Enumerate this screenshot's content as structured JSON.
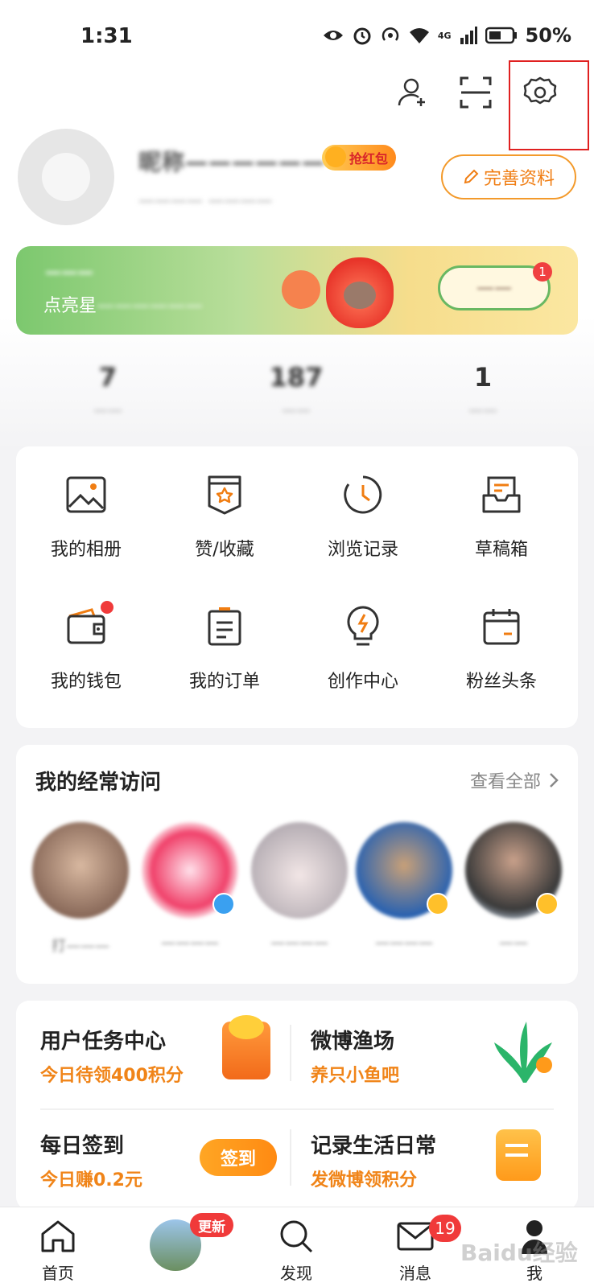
{
  "status_bar": {
    "time": "1:31",
    "network_label": "4G",
    "battery": "50%"
  },
  "header": {
    "add_friend_icon": "person-add-icon",
    "scan_icon": "scan-icon",
    "settings_icon": "gear-icon"
  },
  "profile": {
    "username": "昵称——————",
    "redpacket_label": "抢红包",
    "bio": "———— ————",
    "edit_label": "完善资料"
  },
  "banner": {
    "title": "———",
    "subtitle_prefix": "点亮星",
    "subtitle_hidden": "——————",
    "button_label": "——",
    "badge": "1"
  },
  "stats": [
    {
      "value": "7",
      "label": "——"
    },
    {
      "value": "187",
      "label": "——"
    },
    {
      "value": "1",
      "label": "——"
    }
  ],
  "grid": [
    {
      "label": "我的相册",
      "icon": "image-icon"
    },
    {
      "label": "赞/收藏",
      "icon": "bookmark-star-icon"
    },
    {
      "label": "浏览记录",
      "icon": "clock-icon"
    },
    {
      "label": "草稿箱",
      "icon": "inbox-icon"
    },
    {
      "label": "我的钱包",
      "icon": "wallet-icon"
    },
    {
      "label": "我的订单",
      "icon": "order-list-icon"
    },
    {
      "label": "创作中心",
      "icon": "lightbulb-icon"
    },
    {
      "label": "粉丝头条",
      "icon": "calendar-icon"
    }
  ],
  "frequent": {
    "title": "我的经常访问",
    "more": "查看全部",
    "items": [
      {
        "name": "打———",
        "color": "#b0968a"
      },
      {
        "name": "————",
        "color": "#f0416a"
      },
      {
        "name": "————",
        "color": "#cfc6c8"
      },
      {
        "name": "————",
        "color": "#3a78c0"
      },
      {
        "name": "——",
        "color": "#4a4a4a"
      }
    ]
  },
  "tasks": [
    {
      "title": "用户任务中心",
      "sub": "今日待领400积分"
    },
    {
      "title": "微博渔场",
      "sub": "养只小鱼吧"
    },
    {
      "title": "每日签到",
      "sub": "今日赚0.2元",
      "button": "签到"
    },
    {
      "title": "记录生活日常",
      "sub": "发微博领积分"
    }
  ],
  "tabbar": {
    "home": "首页",
    "update_badge": "更新",
    "discover": "发现",
    "messages": "消息",
    "messages_badge": "19",
    "me": "我"
  },
  "watermark": "Baidu经验"
}
